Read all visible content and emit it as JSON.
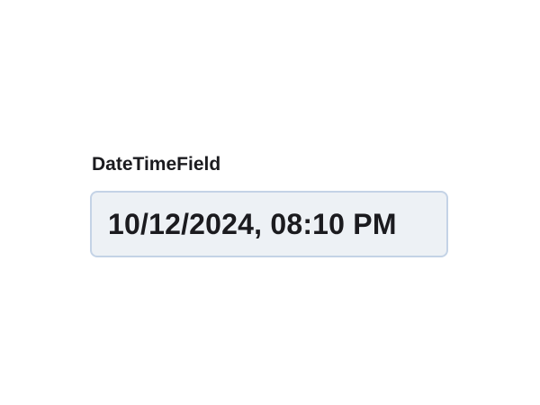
{
  "datetime_field": {
    "label": "DateTimeField",
    "value": "10/12/2024, 08:10 PM"
  },
  "colors": {
    "background": "#ffffff",
    "text": "#1b1b1f",
    "field_background": "#edf1f5",
    "field_border": "#c4d3e6"
  }
}
